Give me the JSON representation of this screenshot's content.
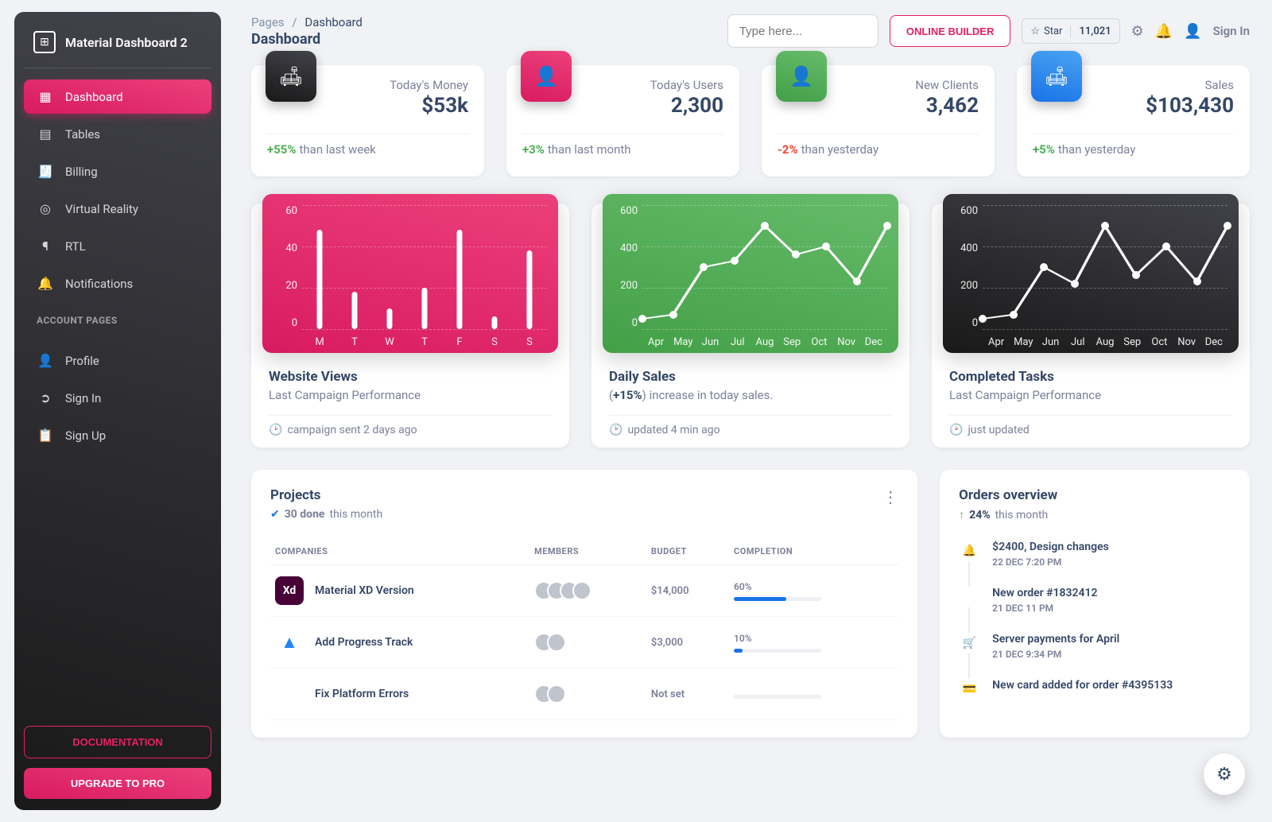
{
  "brand": "Material Dashboard 2",
  "sidebar": {
    "items": [
      {
        "label": "Dashboard",
        "icon": "▦",
        "active": true
      },
      {
        "label": "Tables",
        "icon": "▤"
      },
      {
        "label": "Billing",
        "icon": "🧾"
      },
      {
        "label": "Virtual Reality",
        "icon": "◎"
      },
      {
        "label": "RTL",
        "icon": "¶"
      },
      {
        "label": "Notifications",
        "icon": "🔔"
      }
    ],
    "section_label": "ACCOUNT PAGES",
    "account": [
      {
        "label": "Profile",
        "icon": "👤"
      },
      {
        "label": "Sign In",
        "icon": "➲"
      },
      {
        "label": "Sign Up",
        "icon": "📋"
      }
    ],
    "documentation_label": "DOCUMENTATION",
    "upgrade_label": "UPGRADE TO PRO"
  },
  "breadcrumb": {
    "root": "Pages",
    "current": "Dashboard"
  },
  "page_title": "Dashboard",
  "search_placeholder": "Type here...",
  "online_builder_label": "ONLINE BUILDER",
  "github_star_label": "Star",
  "github_star_count": "11,021",
  "signin_label": "Sign In",
  "stats": [
    {
      "label": "Today's Money",
      "value": "$53k",
      "pct": "+55%",
      "pos": true,
      "txt": "than last week",
      "color": "dark",
      "icon": "🛋"
    },
    {
      "label": "Today's Users",
      "value": "2,300",
      "pct": "+3%",
      "pos": true,
      "txt": "than last month",
      "color": "pink",
      "icon": "👤"
    },
    {
      "label": "New Clients",
      "value": "3,462",
      "pct": "-2%",
      "pos": false,
      "txt": "than yesterday",
      "color": "green",
      "icon": "👤"
    },
    {
      "label": "Sales",
      "value": "$103,430",
      "pct": "+5%",
      "pos": true,
      "txt": "than yesterday",
      "color": "blue",
      "icon": "🛋"
    }
  ],
  "chart_data": [
    {
      "type": "bar",
      "color": "pink",
      "categories": [
        "M",
        "T",
        "W",
        "T",
        "F",
        "S",
        "S"
      ],
      "values": [
        48,
        18,
        10,
        20,
        48,
        6,
        38
      ],
      "yticks": [
        "60",
        "40",
        "20",
        "0"
      ],
      "ymax": 60,
      "title": "Website Views",
      "subtitle": "Last Campaign Performance",
      "subtitle_bold": "",
      "footer": "campaign sent 2 days ago"
    },
    {
      "type": "line",
      "color": "green",
      "categories": [
        "Apr",
        "May",
        "Jun",
        "Jul",
        "Aug",
        "Sep",
        "Oct",
        "Nov",
        "Dec"
      ],
      "values": [
        50,
        70,
        300,
        330,
        500,
        360,
        400,
        230,
        500
      ],
      "yticks": [
        "600",
        "400",
        "200",
        "0"
      ],
      "ymax": 600,
      "title": "Daily Sales",
      "subtitle": ") increase in today sales.",
      "subtitle_bold": "+15%",
      "footer": "updated 4 min ago"
    },
    {
      "type": "line",
      "color": "dark",
      "categories": [
        "Apr",
        "May",
        "Jun",
        "Jul",
        "Aug",
        "Sep",
        "Oct",
        "Nov",
        "Dec"
      ],
      "values": [
        50,
        70,
        300,
        220,
        500,
        260,
        400,
        230,
        500
      ],
      "yticks": [
        "600",
        "400",
        "200",
        "0"
      ],
      "ymax": 600,
      "title": "Completed Tasks",
      "subtitle": "Last Campaign Performance",
      "subtitle_bold": "",
      "footer": "just updated"
    }
  ],
  "projects": {
    "title": "Projects",
    "done_count": "30 done",
    "done_suffix": "this month",
    "columns": [
      "COMPANIES",
      "MEMBERS",
      "BUDGET",
      "COMPLETION"
    ],
    "rows": [
      {
        "logo": "Xd",
        "logo_class": "xd",
        "name": "Material XD Version",
        "members": 4,
        "budget": "$14,000",
        "completion": "60%",
        "pct": 60
      },
      {
        "logo": "▲",
        "logo_class": "at",
        "name": "Add Progress Track",
        "members": 2,
        "budget": "$3,000",
        "completion": "10%",
        "pct": 10
      },
      {
        "logo": "✳",
        "logo_class": "sl",
        "name": "Fix Platform Errors",
        "members": 2,
        "budget": "Not set",
        "completion": "",
        "pct": 0
      }
    ]
  },
  "orders": {
    "title": "Orders overview",
    "pct": "24%",
    "suffix": "this month",
    "items": [
      {
        "icon": "🔔",
        "ic_class": "green",
        "title": "$2400, Design changes",
        "time": "22 DEC 7:20 PM"
      },
      {
        "icon": "</>",
        "ic_class": "red",
        "title": "New order #1832412",
        "time": "21 DEC 11 PM"
      },
      {
        "icon": "🛒",
        "ic_class": "blue",
        "title": "Server payments for April",
        "time": "21 DEC 9:34 PM"
      },
      {
        "icon": "💳",
        "ic_class": "orange",
        "title": "New card added for order #4395133",
        "time": ""
      }
    ]
  }
}
